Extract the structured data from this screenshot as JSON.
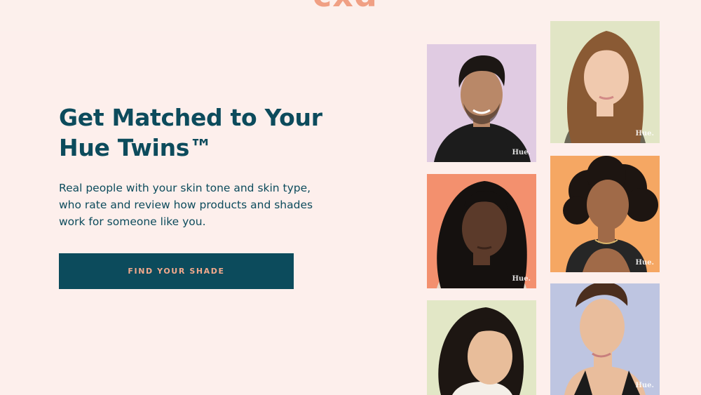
{
  "header": {
    "logo_fragment": "cxd"
  },
  "hero": {
    "title_line1": "Get Matched to Your",
    "title_line2": "Hue Twins™",
    "description_line1": "Real people with your skin tone and skin type,",
    "description_line2": "who rate and review how products and shades",
    "description_line3": "work for someone like you.",
    "cta_label": "FIND YOUR SHADE"
  },
  "photos": [
    {
      "watermark": "Hue.",
      "background": "#e0cbe2",
      "skin": "#b98868",
      "hair": "#1c1714",
      "shirt": "#1c1c1c"
    },
    {
      "watermark": "Hue.",
      "background": "#e1e5c5",
      "skin": "#f0c9ae",
      "hair": "#8a5a34",
      "shirt": "#6b6655"
    },
    {
      "watermark": "Hue.",
      "background": "#f3906e",
      "skin": "#5b3a2a",
      "hair": "#15110f",
      "shirt": "#e7d8c8"
    },
    {
      "watermark": "Hue.",
      "background": "#f5a763",
      "skin": "#a06a48",
      "hair": "#1d1511",
      "shirt": "#262626"
    },
    {
      "watermark": "",
      "background": "#e2e7c6",
      "skin": "#e8bd9a",
      "hair": "#1d1612",
      "shirt": "#f4efe8"
    },
    {
      "watermark": "Hue.",
      "background": "#bec5e1",
      "skin": "#e9bd9c",
      "hair": "#4b2e1e",
      "shirt": "#1b1b1b"
    }
  ],
  "colors": {
    "page_background": "#fdefec",
    "brand_teal": "#0c4b5c",
    "accent_peach": "#f3a98c"
  }
}
